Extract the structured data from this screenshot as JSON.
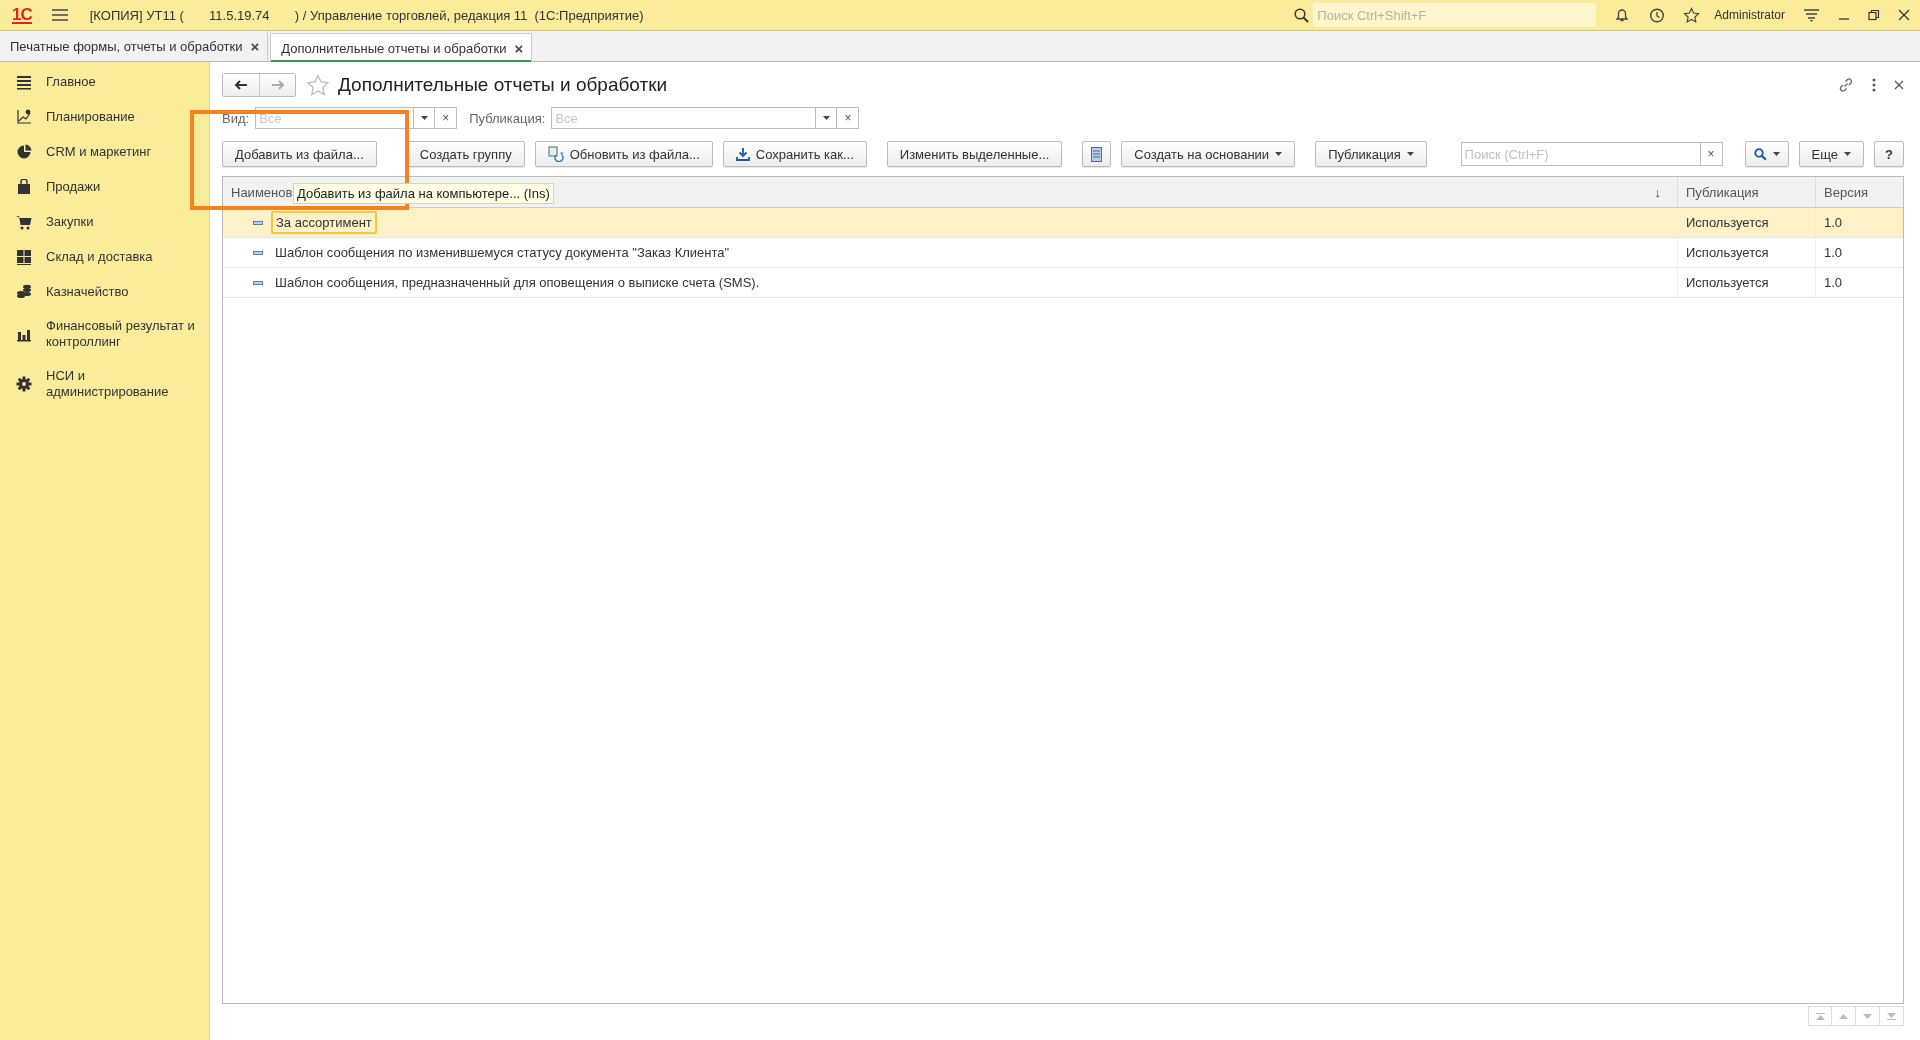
{
  "app_bar": {
    "logo": "1С",
    "title": "[КОПИЯ] УТ11 (       11.5.19.74       ) / Управление торговлей, редакция 11  (1С:Предприятие)",
    "search_placeholder": "Поиск Ctrl+Shift+F",
    "user": "Administrator"
  },
  "open_tabs": [
    {
      "label": "Печатные формы, отчеты и обработки",
      "close": "×",
      "selected": false
    },
    {
      "label": "Дополнительные отчеты и обработки",
      "close": "×",
      "selected": true
    }
  ],
  "sidebar": {
    "items": [
      {
        "label": "Главное",
        "kind": "lines"
      },
      {
        "label": "Планирование",
        "kind": "chart"
      },
      {
        "label": "CRM и маркетинг",
        "kind": "pie"
      },
      {
        "label": "Продажи",
        "kind": "bag"
      },
      {
        "label": "Закупки",
        "kind": "cart"
      },
      {
        "label": "Склад и доставка",
        "kind": "grid"
      },
      {
        "label": "Казначейство",
        "kind": "coins"
      },
      {
        "label": "Финансовый результат и контроллинг",
        "kind": "bars"
      },
      {
        "label": "НСИ и администрирование",
        "kind": "gear"
      }
    ]
  },
  "form": {
    "title": "Дополнительные отчеты и обработки",
    "filters": [
      {
        "label": "Вид:",
        "placeholder": "Все",
        "clear": "×"
      },
      {
        "label": "Публикация:",
        "placeholder": "Все",
        "clear": "×"
      }
    ],
    "toolbar": [
      {
        "kind": "plain",
        "label": "Добавить из файла..."
      },
      {
        "kind": "plain",
        "label": "Создать группу"
      },
      {
        "kind": "refresh",
        "label": "Обновить из файла..."
      },
      {
        "kind": "save",
        "label": "Сохранить как..."
      },
      {
        "kind": "plain",
        "label": "Изменить выделенные..."
      },
      {
        "kind": "list"
      },
      {
        "kind": "menu",
        "label": "Создать на основании"
      },
      {
        "kind": "menu",
        "label": "Публикация"
      }
    ],
    "search": {
      "placeholder": "Поиск (Ctrl+F)",
      "clear": "×"
    },
    "more_button": "Еще",
    "help_button": "?",
    "tooltip": "Добавить из файла на компьютере... (Ins)",
    "table": {
      "columns": [
        {
          "label": "Наименов",
          "sort_mark": "↓"
        },
        {
          "label": "Публикация"
        },
        {
          "label": "Версия"
        }
      ],
      "rows": [
        {
          "name": "За ассортимент",
          "publication": "Используется",
          "version": "1.0",
          "selected": true
        },
        {
          "name": "Шаблон сообщения по изменившемуся статусу документа \"Заказ Клиента\"",
          "publication": "Используется",
          "version": "1.0",
          "selected": false
        },
        {
          "name": "Шаблон сообщения, предназначенный для оповещения о выписке счета (SMS).",
          "publication": "Используется",
          "version": "1.0",
          "selected": false
        }
      ]
    }
  }
}
